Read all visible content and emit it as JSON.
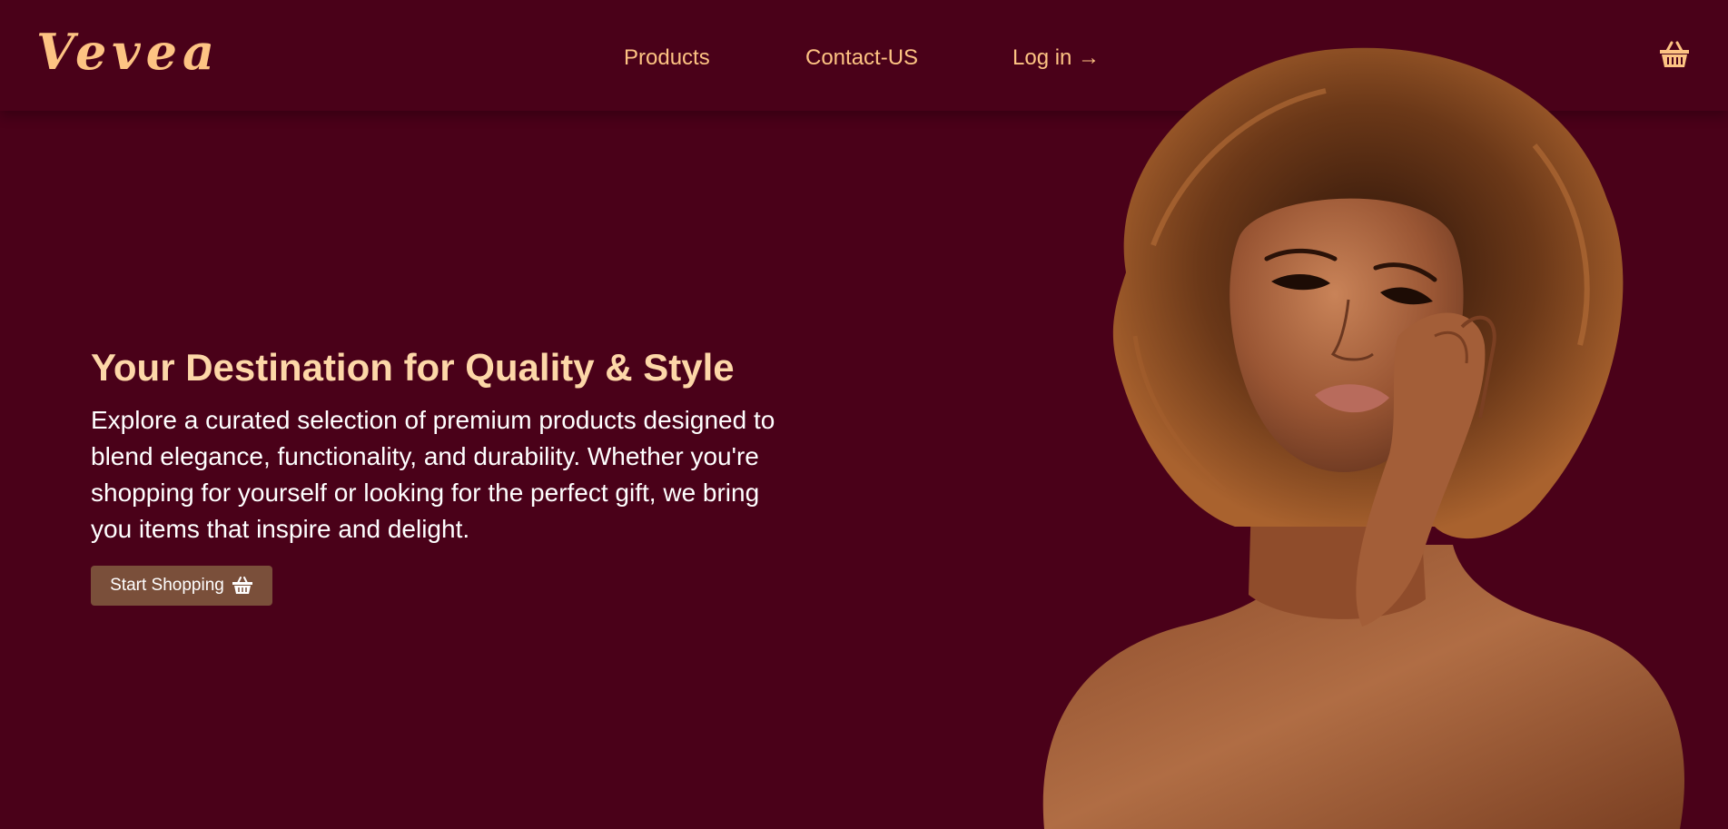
{
  "brand": {
    "logo_text": "Vevea"
  },
  "nav": {
    "items": [
      {
        "label": "Products"
      },
      {
        "label": "Contact-US"
      },
      {
        "label": "Log in →"
      }
    ],
    "cart_icon": "shopping-basket-icon"
  },
  "hero": {
    "headline": "Your Destination for Quality & Style",
    "description": "Explore a curated selection of premium products designed to blend elegance, functionality, and durability. Whether you're shopping for yourself or looking for the perfect gift, we bring you items that inspire and delight.",
    "cta_label": "Start Shopping",
    "cta_icon": "shopping-basket-icon"
  },
  "colors": {
    "background": "#4a0119",
    "accent": "#fdc383",
    "headline": "#fdd7a8",
    "button": "#7a4f3a",
    "text": "#ffffff"
  }
}
